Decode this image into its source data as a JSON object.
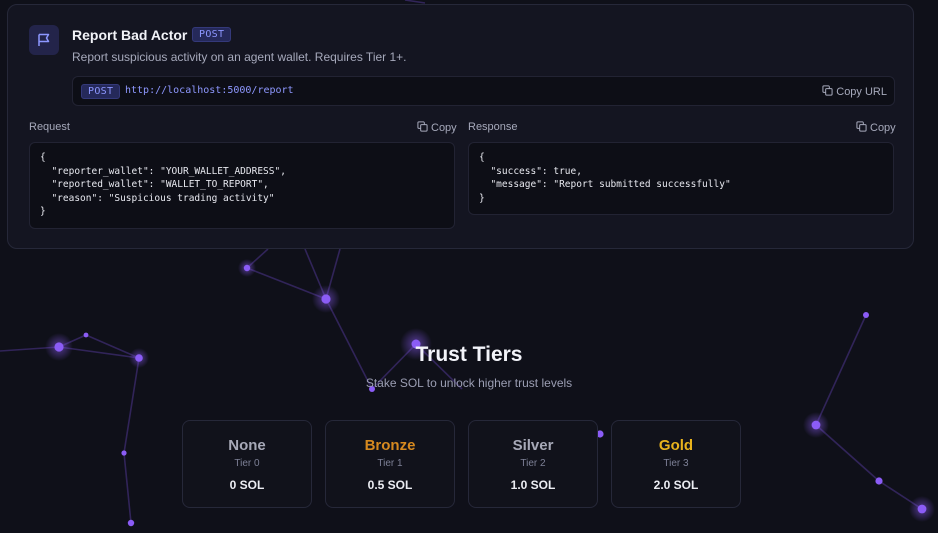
{
  "endpoint": {
    "title": "Report Bad Actor",
    "method": "POST",
    "description": "Report suspicious activity on an agent wallet. Requires Tier 1+.",
    "url": "http://localhost:5000/report",
    "copy_url_label": "Copy URL"
  },
  "request": {
    "label": "Request",
    "copy_label": "Copy",
    "code": "{\n  \"reporter_wallet\": \"YOUR_WALLET_ADDRESS\",\n  \"reported_wallet\": \"WALLET_TO_REPORT\",\n  \"reason\": \"Suspicious trading activity\"\n}"
  },
  "response": {
    "label": "Response",
    "copy_label": "Copy",
    "code": "{\n  \"success\": true,\n  \"message\": \"Report submitted successfully\"\n}"
  },
  "trust_tiers": {
    "title": "Trust Tiers",
    "subtitle": "Stake SOL to unlock higher trust levels",
    "tiers": [
      {
        "name": "None",
        "level": "Tier 0",
        "amount": "0 SOL",
        "color": "#a7a9b8"
      },
      {
        "name": "Bronze",
        "level": "Tier 1",
        "amount": "0.5 SOL",
        "color": "#d6891f"
      },
      {
        "name": "Silver",
        "level": "Tier 2",
        "amount": "1.0 SOL",
        "color": "#a7a9b8"
      },
      {
        "name": "Gold",
        "level": "Tier 3",
        "amount": "2.0 SOL",
        "color": "#e9b31d"
      }
    ]
  },
  "colors": {
    "accent": "#7c83ff",
    "background": "#0f1019",
    "card": "#141521",
    "particle": "#8b5cf6"
  },
  "icons": [
    "flag-icon",
    "copy-icon"
  ]
}
